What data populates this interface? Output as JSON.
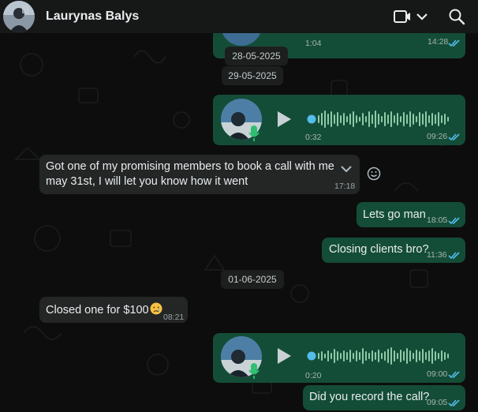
{
  "header": {
    "contact_name": "Laurynas Balys",
    "icons": [
      "avatar",
      "video-call-icon",
      "chevron-down-icon",
      "search-icon"
    ]
  },
  "colors": {
    "outgoing_bubble": "#144d37",
    "incoming_bubble": "#242626",
    "read_ticks": "#53bdeb",
    "waveform": "#7ad9a3"
  },
  "messages": {
    "top_voice": {
      "duration": "1:04",
      "time": "14:28"
    },
    "date_1": "28-05-2025",
    "date_2": "29-05-2025",
    "voice_1": {
      "duration": "0:32",
      "time": "09:26"
    },
    "msg_1": {
      "line1": "Got one of my promising members to book a call with me on",
      "line2": "may 31st, I will let you know how it went",
      "time": "17:18"
    },
    "msg_2": {
      "text": "Lets go man",
      "time": "18:05"
    },
    "msg_3": {
      "text": "Closing clients bro?",
      "time": "11:36"
    },
    "date_3": "01-06-2025",
    "msg_4": {
      "text": "Closed one for $100",
      "emoji": "crying-face",
      "time": "08:21"
    },
    "voice_2": {
      "duration": "0:20",
      "time": "09:00"
    },
    "msg_5": {
      "text": "Did you record the call?",
      "time": "09:05"
    }
  }
}
